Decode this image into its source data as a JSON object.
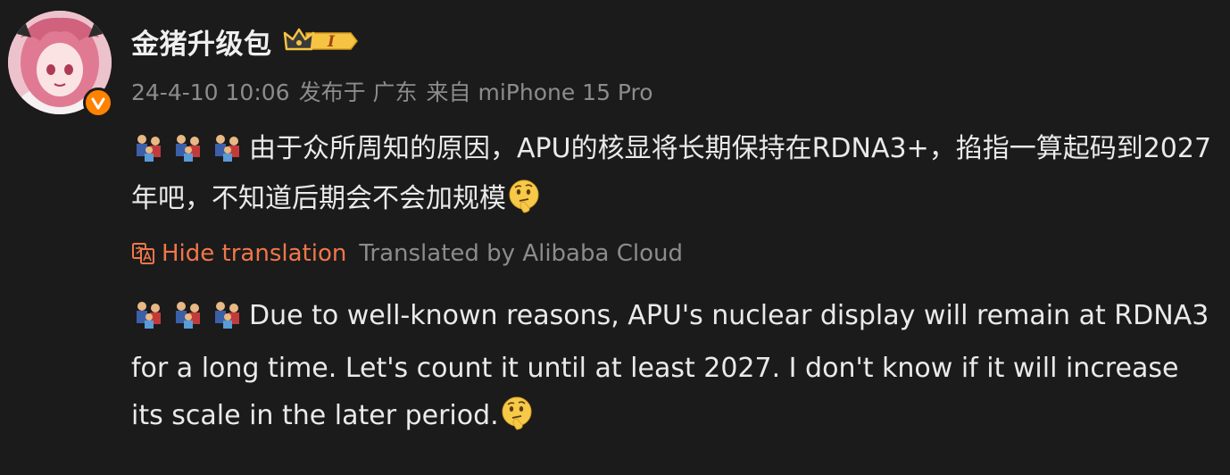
{
  "post": {
    "username": "金猪升级包",
    "badge_text": "I",
    "date": "24-4-10 10:06",
    "location": "发布于 广东",
    "source": "来自 miPhone 15 Pro",
    "content": "由于众所周知的原因，APU的核显将长期保持在RDNA3+，掐指一算起码到2027年吧，不知道后期会不会加规模",
    "content_emoji": "thinking-face-emoji",
    "translation": {
      "hide_label": "Hide translation",
      "provider_label": "Translated by Alibaba Cloud",
      "text": "Due to well-known reasons, APU's nuclear display will remain at RDNA3 for a long time. Let's count it until at least 2027. I don't know if it will increase its scale in the later period."
    }
  },
  "colors": {
    "background": "#1b1b1b",
    "accent_orange": "#f0774a",
    "verified_orange": "#ff8200",
    "meta_gray": "#8c8c8c"
  }
}
